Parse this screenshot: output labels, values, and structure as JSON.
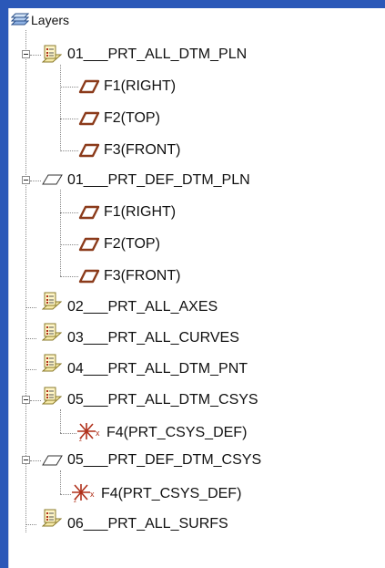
{
  "tree": {
    "root_label": "Layers",
    "nodes": [
      {
        "label": "01___PRT_ALL_DTM_PLN",
        "icon": "layer-icon",
        "expanded": true
      },
      {
        "label": "F1(RIGHT)",
        "icon": "datum-plane-icon"
      },
      {
        "label": "F2(TOP)",
        "icon": "datum-plane-icon"
      },
      {
        "label": "F3(FRONT)",
        "icon": "datum-plane-icon"
      },
      {
        "label": "01___PRT_DEF_DTM_PLN",
        "icon": "plane-outline-icon",
        "expanded": true
      },
      {
        "label": "F1(RIGHT)",
        "icon": "datum-plane-icon"
      },
      {
        "label": "F2(TOP)",
        "icon": "datum-plane-icon"
      },
      {
        "label": "F3(FRONT)",
        "icon": "datum-plane-icon"
      },
      {
        "label": "02___PRT_ALL_AXES",
        "icon": "layer-icon"
      },
      {
        "label": "03___PRT_ALL_CURVES",
        "icon": "layer-icon"
      },
      {
        "label": "04___PRT_ALL_DTM_PNT",
        "icon": "layer-icon"
      },
      {
        "label": "05___PRT_ALL_DTM_CSYS",
        "icon": "layer-icon",
        "expanded": true
      },
      {
        "label": "F4(PRT_CSYS_DEF)",
        "icon": "csys-icon"
      },
      {
        "label": "05___PRT_DEF_DTM_CSYS",
        "icon": "plane-outline-icon",
        "expanded": true
      },
      {
        "label": "F4(PRT_CSYS_DEF)",
        "icon": "csys-icon"
      },
      {
        "label": "06___PRT_ALL_SURFS",
        "icon": "layer-icon"
      }
    ]
  },
  "colors": {
    "background": "#2b58b8",
    "panel": "#ffffff",
    "datum_plane": "#8b3a1a",
    "csys": "#b0301a"
  }
}
